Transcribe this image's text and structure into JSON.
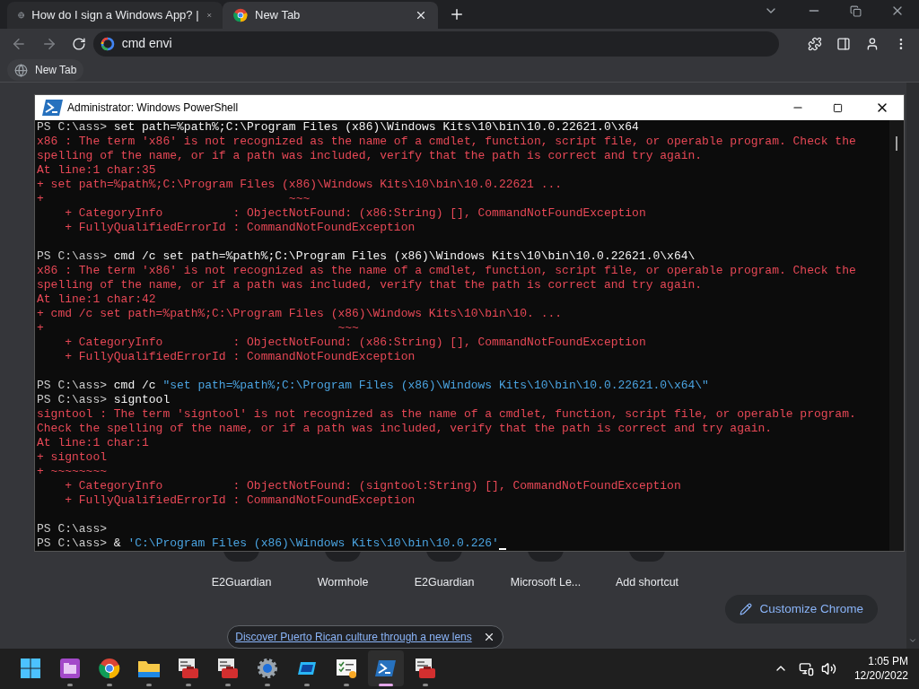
{
  "browser": {
    "tabs": [
      {
        "title": "How do I sign a Windows App? |",
        "selected": false
      },
      {
        "title": "New Tab",
        "selected": true
      }
    ],
    "address": "cmd envi",
    "bookmarks": [
      "New Tab"
    ]
  },
  "new_tab_page": {
    "shortcuts": [
      "E2Guardian",
      "Wormhole",
      "E2Guardian",
      "Microsoft Le...",
      "Add shortcut"
    ],
    "customize_button": "Customize Chrome",
    "doodle_link": "Discover Puerto Rican culture through a new lens"
  },
  "powershell": {
    "title": "Administrator: Windows PowerShell",
    "lines": [
      {
        "kind": "command",
        "prompt": "PS C:\\ass>",
        "parts": [
          {
            "kind": "plain",
            "text": "set path=%path%;C:\\Program Files (x86)\\Windows Kits\\10\\bin\\10.0.22621.0\\x64"
          }
        ]
      },
      {
        "kind": "error",
        "text": "x86 : The term 'x86' is not recognized as the name of a cmdlet, function, script file, or operable program. Check the"
      },
      {
        "kind": "error",
        "text": "spelling of the name, or if a path was included, verify that the path is correct and try again."
      },
      {
        "kind": "error",
        "text": "At line:1 char:35"
      },
      {
        "kind": "error",
        "text": "+ set path=%path%;C:\\Program Files (x86)\\Windows Kits\\10\\bin\\10.0.22621 ..."
      },
      {
        "kind": "error",
        "text": "+                                   ~~~"
      },
      {
        "kind": "error",
        "text": "    + CategoryInfo          : ObjectNotFound: (x86:String) [], CommandNotFoundException"
      },
      {
        "kind": "error",
        "text": "    + FullyQualifiedErrorId : CommandNotFoundException"
      },
      {
        "kind": "blank"
      },
      {
        "kind": "command",
        "prompt": "PS C:\\ass>",
        "parts": [
          {
            "kind": "plain",
            "text": "cmd /c set path=%path%;C:\\Program Files (x86)\\Windows Kits\\10\\bin\\10.0.22621.0\\x64\\"
          }
        ]
      },
      {
        "kind": "error",
        "text": "x86 : The term 'x86' is not recognized as the name of a cmdlet, function, script file, or operable program. Check the"
      },
      {
        "kind": "error",
        "text": "spelling of the name, or if a path was included, verify that the path is correct and try again."
      },
      {
        "kind": "error",
        "text": "At line:1 char:42"
      },
      {
        "kind": "error",
        "text": "+ cmd /c set path=%path%;C:\\Program Files (x86)\\Windows Kits\\10\\bin\\10. ..."
      },
      {
        "kind": "error",
        "text": "+                                          ~~~"
      },
      {
        "kind": "error",
        "text": "    + CategoryInfo          : ObjectNotFound: (x86:String) [], CommandNotFoundException"
      },
      {
        "kind": "error",
        "text": "    + FullyQualifiedErrorId : CommandNotFoundException"
      },
      {
        "kind": "blank"
      },
      {
        "kind": "command",
        "prompt": "PS C:\\ass>",
        "parts": [
          {
            "kind": "plain",
            "text": "cmd /c"
          },
          {
            "kind": "string",
            "text": "\"set path=%path%;C:\\Program Files (x86)\\Windows Kits\\10\\bin\\10.0.22621.0\\x64\\\""
          }
        ]
      },
      {
        "kind": "command",
        "prompt": "PS C:\\ass>",
        "parts": [
          {
            "kind": "plain",
            "text": "signtool"
          }
        ]
      },
      {
        "kind": "error",
        "text": "signtool : The term 'signtool' is not recognized as the name of a cmdlet, function, script file, or operable program."
      },
      {
        "kind": "error",
        "text": "Check the spelling of the name, or if a path was included, verify that the path is correct and try again."
      },
      {
        "kind": "error",
        "text": "At line:1 char:1"
      },
      {
        "kind": "error",
        "text": "+ signtool"
      },
      {
        "kind": "error",
        "text": "+ ~~~~~~~~"
      },
      {
        "kind": "error",
        "text": "    + CategoryInfo          : ObjectNotFound: (signtool:String) [], CommandNotFoundException"
      },
      {
        "kind": "error",
        "text": "    + FullyQualifiedErrorId : CommandNotFoundException"
      },
      {
        "kind": "blank"
      },
      {
        "kind": "command",
        "prompt": "PS C:\\ass>"
      },
      {
        "kind": "command",
        "prompt": "PS C:\\ass>",
        "parts": [
          {
            "kind": "plain",
            "text": "&"
          },
          {
            "kind": "string",
            "text": "'C:\\Program Files (x86)\\Windows Kits\\10\\bin\\10.0.226'"
          }
        ],
        "cursor": true
      }
    ]
  },
  "taskbar": {
    "apps": [
      {
        "kind": "start",
        "open": false,
        "selected": false
      },
      {
        "kind": "files",
        "open": true,
        "selected": false
      },
      {
        "kind": "chrome",
        "open": true,
        "selected": false
      },
      {
        "kind": "folder",
        "open": true,
        "selected": false
      },
      {
        "kind": "toolbox",
        "open": true,
        "selected": false
      },
      {
        "kind": "toolbox",
        "open": true,
        "selected": false
      },
      {
        "kind": "gear",
        "open": true,
        "selected": false
      },
      {
        "kind": "remote",
        "open": true,
        "selected": false
      },
      {
        "kind": "checklist",
        "open": true,
        "selected": false
      },
      {
        "kind": "terminal",
        "open": true,
        "selected": true
      },
      {
        "kind": "toolbox",
        "open": true,
        "selected": false
      }
    ],
    "time": "1:05 PM",
    "date": "12/20/2022"
  }
}
